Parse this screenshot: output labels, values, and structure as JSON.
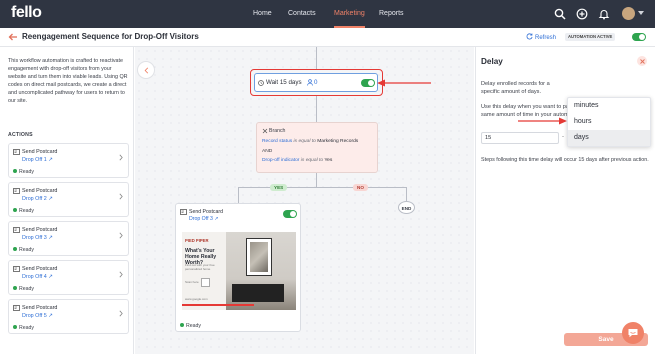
{
  "app": {
    "logo": "fello"
  },
  "topnav": {
    "items": [
      {
        "label": "Home"
      },
      {
        "label": "Contacts"
      },
      {
        "label": "Marketing",
        "active": true
      },
      {
        "label": "Reports"
      }
    ],
    "icons": [
      "search-icon",
      "add-circle-icon",
      "bell-icon",
      "avatar",
      "chevron-down-icon"
    ]
  },
  "header": {
    "title": "Reengagement Sequence for Drop-Off Visitors",
    "refresh_label": "Refresh",
    "status_badge": "AUTOMATION ACTIVE",
    "automation_active": true
  },
  "left_panel": {
    "description": "This workflow automation is crafted to reactivate engagement with drop-off visitors from your website and turn them into viable leads. Using QR codes on direct mail postcards, we create a direct and uncomplicated pathway for users to return to our site.",
    "actions_heading": "ACTIONS",
    "actions": [
      {
        "name": "Send Postcard",
        "link": "Drop Off 1",
        "status": "Ready"
      },
      {
        "name": "Send Postcard",
        "link": "Drop Off 2",
        "status": "Ready"
      },
      {
        "name": "Send Postcard",
        "link": "Drop Off 3",
        "status": "Ready"
      },
      {
        "name": "Send Postcard",
        "link": "Drop Off 4",
        "status": "Ready"
      },
      {
        "name": "Send Postcard",
        "link": "Drop Off 5",
        "status": "Ready"
      }
    ]
  },
  "canvas": {
    "wait_node": {
      "label": "Wait 15 days",
      "count": "0",
      "enabled": true
    },
    "branch_node": {
      "label": "Branch",
      "cond1_field": "Record status",
      "cond1_op": "is equal to",
      "cond1_value": "Marketing Records",
      "joiner": "AND",
      "cond2_field": "Drop-off indicator",
      "cond2_op": "is equal to",
      "cond2_value": "Yes"
    },
    "yes_label": "YES",
    "no_label": "NO",
    "end_label": "END",
    "postcard_node": {
      "name": "Send Postcard",
      "link": "Drop Off 3",
      "status": "Ready",
      "enabled": true,
      "preview": {
        "brand": "PIED PIPER",
        "headline": "What's Your Home Really Worth?",
        "subtext": "Find out with your free personalized home",
        "scan_text": "Scan here",
        "url": "www.google.com"
      }
    }
  },
  "right_panel": {
    "title": "Delay",
    "description_top": "Delay enrolled records for a specific amount of days.",
    "description_rest": "Use this delay when you want to pause all enrolled records for the same amount of time in your automation actions.",
    "delay_value": "15",
    "unit_options": [
      "minutes",
      "hours",
      "days"
    ],
    "selected_unit": "days",
    "note": "Steps following this time delay will occur 15 days after previous action.",
    "save_label": "Save"
  },
  "colors": {
    "nav_bg": "#2f3542",
    "accent": "#f08268",
    "link": "#2f6fd6",
    "success": "#2ea44f",
    "highlight": "#e53935"
  }
}
